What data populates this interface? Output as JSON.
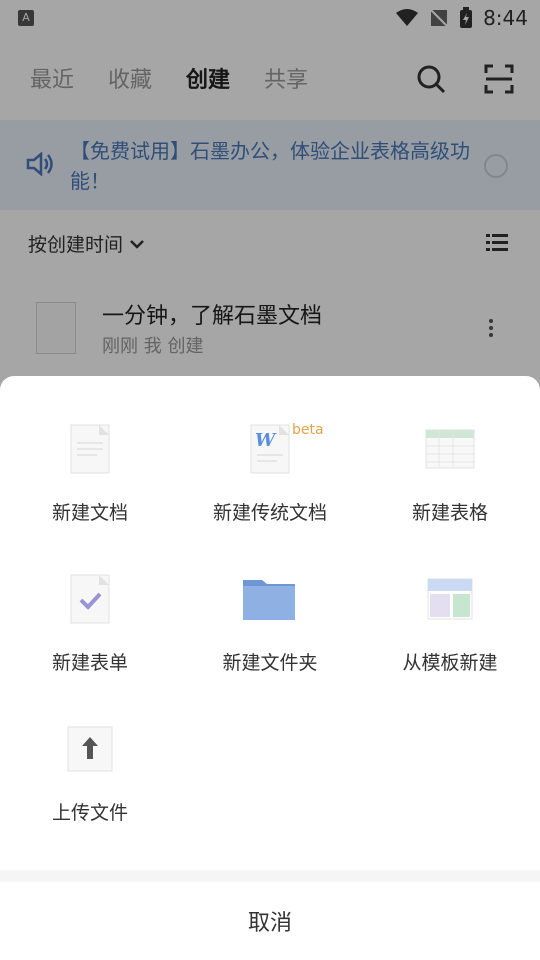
{
  "status": {
    "time": "8:44",
    "left_badge": "A"
  },
  "nav": {
    "tabs": [
      {
        "label": "最近"
      },
      {
        "label": "收藏"
      },
      {
        "label": "创建"
      },
      {
        "label": "共享"
      }
    ],
    "icons": [
      "search-icon",
      "scan-icon"
    ]
  },
  "banner": {
    "text": "【免费试用】石墨办公，体验企业表格高级功能！",
    "icons": [
      "speaker-icon",
      "close-icon"
    ]
  },
  "sort": {
    "label": "按创建时间"
  },
  "documents": [
    {
      "title": "一分钟，了解石墨文档",
      "meta": "刚刚 我 创建"
    }
  ],
  "sheet": {
    "actions": [
      {
        "label": "新建文档",
        "icon": "doc-icon"
      },
      {
        "label": "新建传统文档",
        "icon": "word-doc-icon"
      },
      {
        "label": "新建表格",
        "icon": "sheet-icon"
      },
      {
        "label": "新建表单",
        "icon": "form-icon"
      },
      {
        "label": "新建文件夹",
        "icon": "folder-icon"
      },
      {
        "label": "从模板新建",
        "icon": "template-icon"
      },
      {
        "label": "上传文件",
        "icon": "upload-icon"
      }
    ],
    "beta_badge": "beta",
    "cancel_label": "取消"
  },
  "colors": {
    "accent": "#4a78b8",
    "beta": "#e4a24a",
    "folder": "#7aa2dc"
  }
}
